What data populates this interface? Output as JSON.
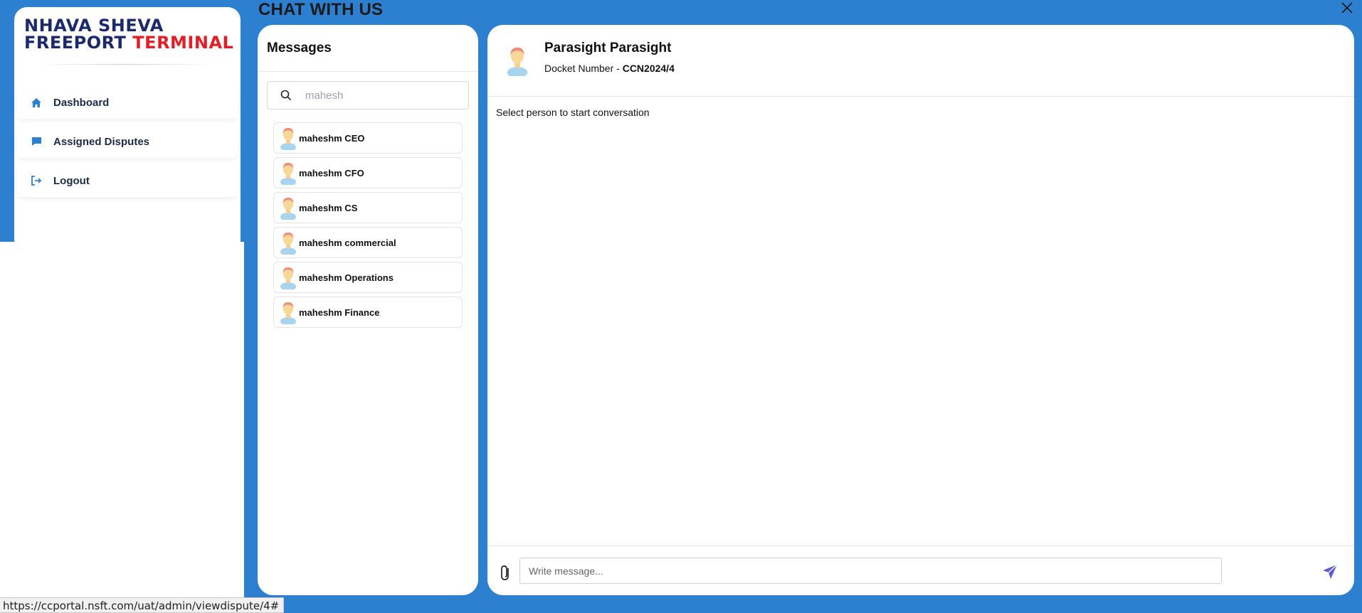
{
  "brand": {
    "line1": "NHAVA SHEVA",
    "line2_a": "FREEPORT ",
    "line2_b": "TERMINAL",
    "accent_red": "#e31e24",
    "navy": "#1b2a6b"
  },
  "sidebar": {
    "items": [
      {
        "label": "Dashboard",
        "icon": "home-icon"
      },
      {
        "label": "Assigned Disputes",
        "icon": "chat-bubble-icon"
      },
      {
        "label": "Logout",
        "icon": "logout-icon"
      }
    ]
  },
  "modal": {
    "title": "CHAT WITH US",
    "close_icon": "close-icon",
    "background": "#2d80d0"
  },
  "messages": {
    "title": "Messages",
    "search": {
      "value": "",
      "placeholder": "mahesh"
    },
    "contacts": [
      {
        "name": "maheshm CEO"
      },
      {
        "name": "maheshm CFO"
      },
      {
        "name": "maheshm CS"
      },
      {
        "name": "maheshm commercial"
      },
      {
        "name": "maheshm Operations"
      },
      {
        "name": "maheshm Finance"
      }
    ]
  },
  "chat": {
    "name": "Parasight Parasight",
    "docket_label": "Docket Number - ",
    "docket_value": "CCN2024/4",
    "placeholder_text": "Select person to start conversation",
    "input": {
      "value": "",
      "placeholder": "Write message..."
    },
    "send_color": "#5b5bd6"
  },
  "status_bar": {
    "url": "https://ccportal.nsft.com/uat/admin/viewdispute/4#"
  }
}
